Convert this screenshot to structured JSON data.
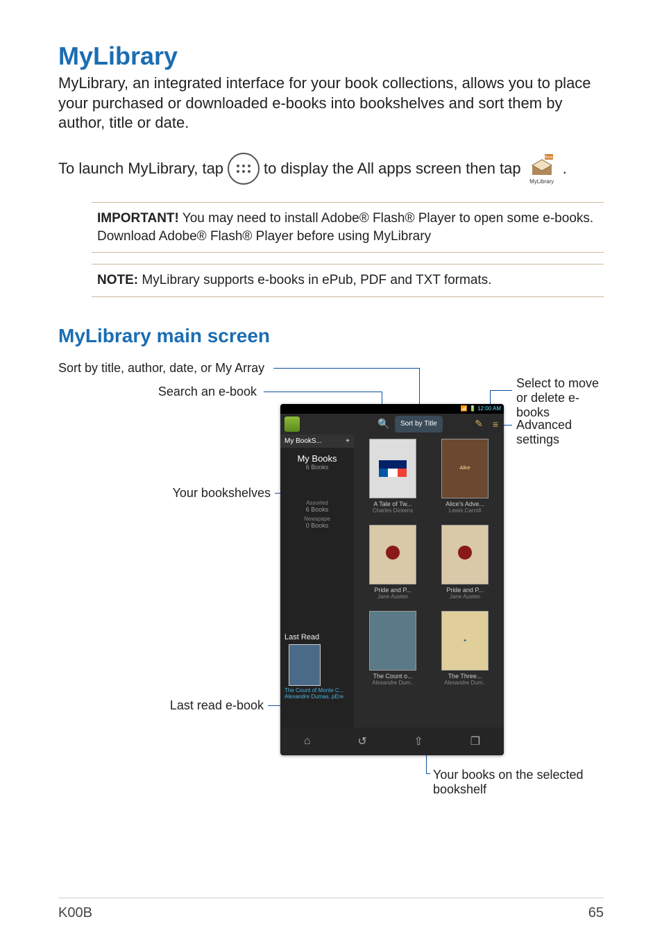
{
  "headings": {
    "title": "MyLibrary",
    "subtitle": "MyLibrary main screen"
  },
  "paragraphs": {
    "intro": "MyLibrary, an integrated interface for your book collections, allows you to place your purchased or downloaded e-books into bookshelves and sort them by author, title or date.",
    "launch_pre": "To launch MyLibrary, tap",
    "launch_mid": "to display the All apps screen then tap",
    "launch_post": ".",
    "mylib_icon_caption": "MyLibrary"
  },
  "notices": {
    "important_label": "IMPORTANT!",
    "important_body": "  You may need to install Adobe® Flash® Player to open some e-books. Download Adobe® Flash® Player before using MyLibrary",
    "note_label": "NOTE:",
    "note_body": "  MyLibrary supports e-books in ePub, PDF and TXT formats."
  },
  "callouts": {
    "sort": "Sort by title, author, date, or My Array",
    "search": "Search an e-book",
    "bookshelves": "Your bookshelves",
    "lastread": "Last read e-book",
    "select": "Select to move or delete e-books",
    "advanced": "Advanced settings",
    "yourbooks": "Your books on the selected bookshelf"
  },
  "screenshot": {
    "time": "12:00 AM",
    "status_icons": "📶 🔋",
    "toolbar": {
      "sort_label": "Sort by Title",
      "search_glyph": "🔍",
      "edit_glyph": "✎",
      "menu_glyph": "≡"
    },
    "sidebar": {
      "tab_label": "My BookS...",
      "tab_plus": "+",
      "shelves": [
        {
          "name": "My Books",
          "count": "6 Books"
        },
        {
          "name": "Assorted",
          "count": "6 Books"
        },
        {
          "name": "Newspape",
          "count": "0 Books"
        }
      ],
      "lastread_label": "Last Read",
      "lastread_title": "The Count of Monte C...",
      "lastread_author": "Alexandre Dumas, pEre"
    },
    "books": [
      {
        "title": "A Tale of Tw...",
        "author": "Charles Dickens",
        "cover": "#e8e8e8"
      },
      {
        "title": "Alice's Adve...",
        "author": "Lewis Carroll",
        "cover": "#6b4830"
      },
      {
        "title": "Pride and P...",
        "author": "Jane Austen",
        "cover": "#d9c9a8"
      },
      {
        "title": "Pride and P...",
        "author": "Jane Austen",
        "cover": "#d9c9a8"
      },
      {
        "title": "The Count o...",
        "author": "Alexandre Dum..",
        "cover": "#5a7a88"
      },
      {
        "title": "The Three...",
        "author": "Alexandre Dum..",
        "cover": "#e0cf9a"
      }
    ],
    "navbar": [
      "⌂",
      "↺",
      "⇧",
      "❐"
    ]
  },
  "footer": {
    "model": "K00B",
    "page": "65"
  }
}
